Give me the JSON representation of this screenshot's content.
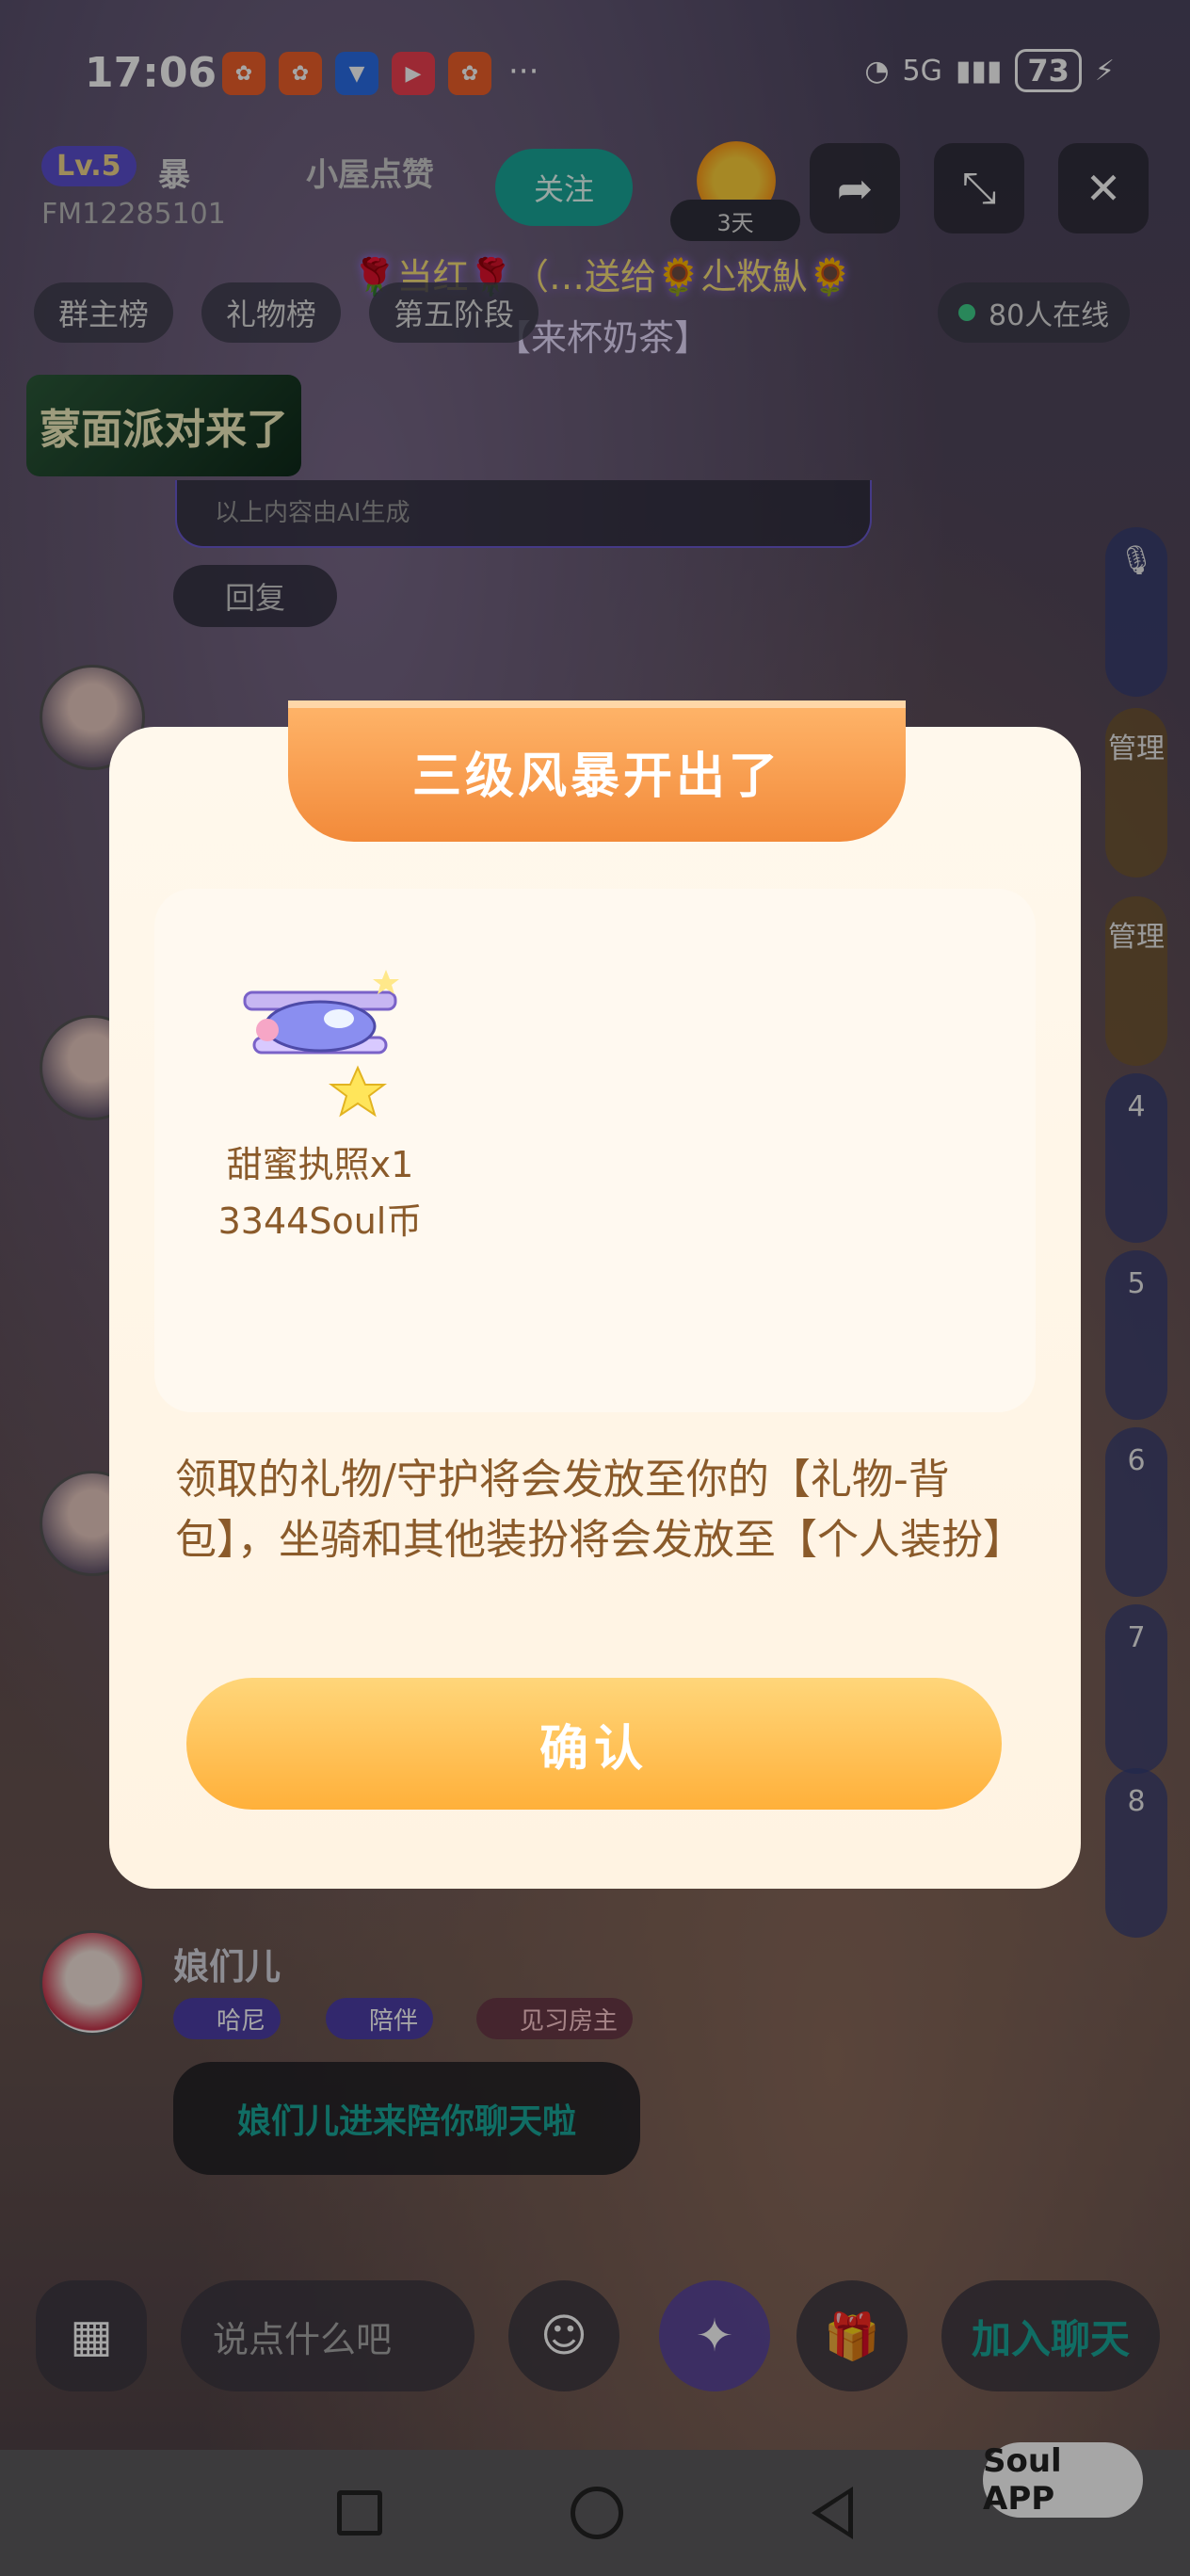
{
  "status_bar": {
    "time": "17:06",
    "network": "5G",
    "battery": "73"
  },
  "room": {
    "level": "Lv.5",
    "name_fragment": "暴",
    "title": "小屋点赞",
    "room_id": "FM12285101",
    "follow_label": "关注",
    "days_badge": "3天",
    "banner_message": "🌹当红🌹（…送给🌻尐敉魜🌻",
    "banner_sub": "【来杯奶茶】",
    "tabs": [
      "群主榜",
      "礼物榜",
      "第五阶段"
    ],
    "online_count": "80人在线",
    "party_banner": "蒙面派对来了",
    "ai_note": "以上内容由AI生成",
    "reply_label": "回复"
  },
  "mic_seats": [
    {
      "label": "管理"
    },
    {
      "label": "管理"
    },
    {
      "label": "4"
    },
    {
      "label": "5"
    },
    {
      "label": "6"
    },
    {
      "label": "7"
    },
    {
      "label": "8"
    }
  ],
  "chat": {
    "user_name": "娘们儿",
    "chips": [
      "哈尼",
      "陪伴",
      "见习房主"
    ],
    "message": "娘们儿进来陪你聊天啦"
  },
  "toolbar": {
    "input_placeholder": "说点什么吧",
    "join_label": "加入聊天"
  },
  "modal": {
    "title": "三级风暴开出了",
    "gift_name": "甜蜜执照x1",
    "gift_price": "3344Soul币",
    "description": "领取的礼物/守护将会发放至你的【礼物-背包】，坐骑和其他装扮将会发放至【个人装扮】",
    "confirm_label": "确认"
  },
  "watermark": "Soul APP"
}
